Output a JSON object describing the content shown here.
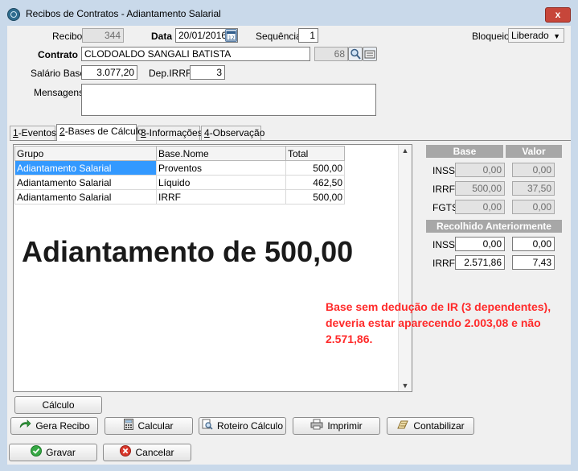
{
  "window": {
    "title": "Recibos de Contratos - Adiantamento Salarial",
    "close_label": "x"
  },
  "header": {
    "recibo_label": "Recibo",
    "recibo_value": "344",
    "data_label": "Data",
    "data_value": "20/01/2016",
    "sequencia_label": "Sequência",
    "sequencia_value": "1",
    "bloqueio_label": "Bloqueio",
    "bloqueio_value": "Liberado",
    "contrato_label": "Contrato",
    "contrato_value": "CLODOALDO SANGALI BATISTA",
    "contrato_code": "68",
    "salario_label": "Salário Base",
    "salario_value": "3.077,20",
    "depirrf_label": "Dep.IRRF",
    "depirrf_value": "3",
    "mensagens_label": "Mensagens"
  },
  "tabs": [
    {
      "key": "1",
      "rest": "-Eventos"
    },
    {
      "key": "2",
      "rest": "-Bases de Cálculo"
    },
    {
      "key": "3",
      "rest": "-Informações"
    },
    {
      "key": "4",
      "rest": "-Observação"
    }
  ],
  "grid": {
    "columns": [
      "Grupo",
      "Base.Nome",
      "Total"
    ],
    "rows": [
      [
        "Adiantamento Salarial",
        "Proventos",
        "500,00"
      ],
      [
        "Adiantamento Salarial",
        "Líquido",
        "462,50"
      ],
      [
        "Adiantamento Salarial",
        "IRRF",
        "500,00"
      ]
    ]
  },
  "annotation_big": "Adiantamento de 500,00",
  "annotation_note": "Base sem dedução de IR (3 dependentes), deveria estar aparecendo 2.003,08 e não 2.571,86.",
  "side": {
    "base_header": "Base",
    "valor_header": "Valor",
    "inss_label": "INSS",
    "inss_base": "0,00",
    "inss_valor": "0,00",
    "irrf_label": "IRRF",
    "irrf_base": "500,00",
    "irrf_valor": "37,50",
    "fgts_label": "FGTS",
    "fgts_base": "0,00",
    "fgts_valor": "0,00",
    "recolhido_header": "Recolhido Anteriormente",
    "r_inss_label": "INSS",
    "r_inss_base": "0,00",
    "r_inss_valor": "0,00",
    "r_irrf_label": "IRRF",
    "r_irrf_base": "2.571,86",
    "r_irrf_valor": "7,43"
  },
  "buttons": {
    "calculo": "Cálculo",
    "gera_recibo": "Gera Recibo",
    "calcular": "Calcular",
    "roteiro": "Roteiro Cálculo",
    "imprimir": "Imprimir",
    "contabilizar": "Contabilizar",
    "gravar": "Gravar",
    "cancelar": "Cancelar"
  },
  "colors": {
    "accent": "#3399ff",
    "note": "#ff2a2a",
    "window_frame": "#c9d9ea"
  }
}
